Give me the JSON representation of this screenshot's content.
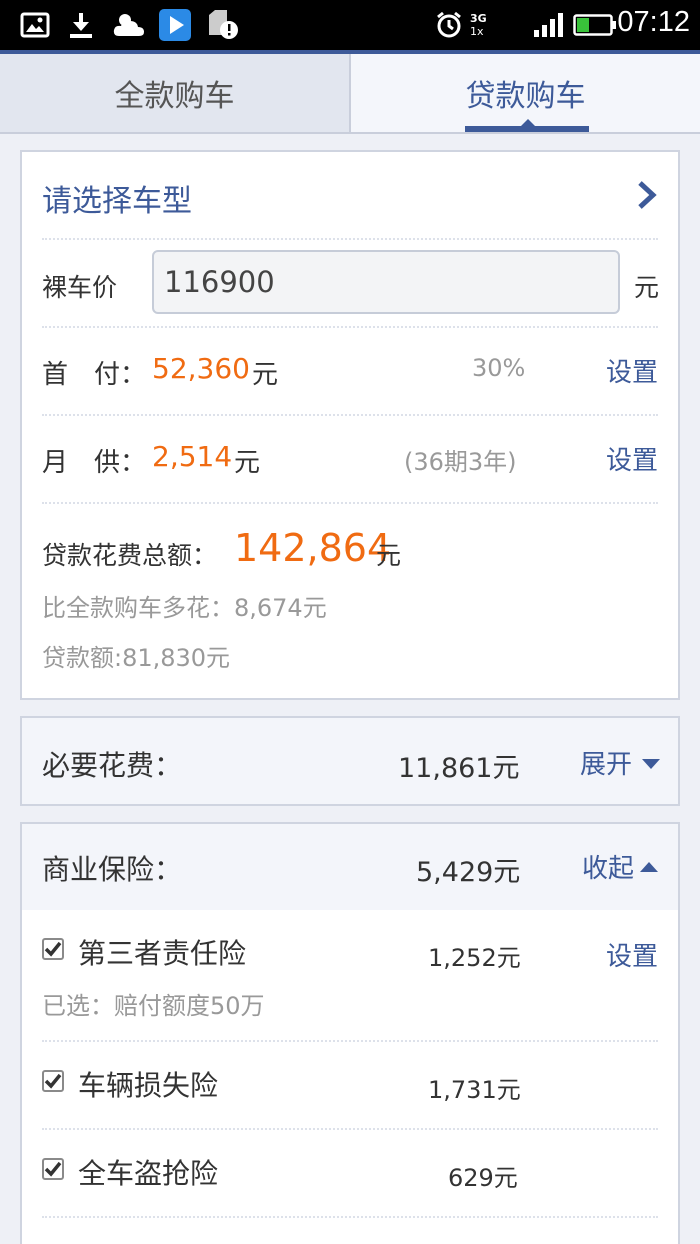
{
  "status_bar": {
    "time": "07:12",
    "network_top": "3G",
    "network_bottom": "1x"
  },
  "tabs": [
    {
      "label": "全款购车",
      "active": false
    },
    {
      "label": "贷款购车",
      "active": true
    }
  ],
  "loan_card": {
    "select_model_label": "请选择车型",
    "bare_price_label": "裸车价",
    "bare_price_value": "116900",
    "bare_price_unit": "元",
    "down_payment_label": "首　付：",
    "down_payment_value": "52,360",
    "down_payment_unit": "元",
    "down_payment_percent": "30%",
    "down_payment_action": "设置",
    "monthly_label": "月　供：",
    "monthly_value": "2,514",
    "monthly_unit": "元",
    "monthly_term": "(36期3年)",
    "monthly_action": "设置",
    "total_label": "贷款花费总额：",
    "total_value": "142,864",
    "total_unit": "元",
    "extra_cost_text": "比全款购车多花：8,674元",
    "loan_amount_text": "贷款额:81,830元"
  },
  "necessary_fees": {
    "label": "必要花费：",
    "amount": "11,861元",
    "action": "展开"
  },
  "commercial_insurance": {
    "label": "商业保险：",
    "amount": "5,429元",
    "action": "收起",
    "items": [
      {
        "name": "第三者责任险",
        "amount": "1,252元",
        "action": "设置",
        "note": "已选：赔付额度50万",
        "checked": true
      },
      {
        "name": "车辆损失险",
        "amount": "1,731元",
        "checked": true
      },
      {
        "name": "全车盗抢险",
        "amount": "629元",
        "checked": true
      }
    ]
  }
}
